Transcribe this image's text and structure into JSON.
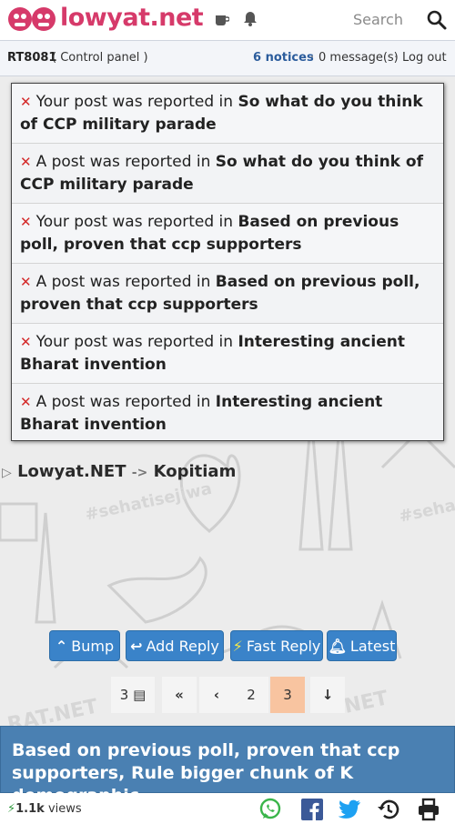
{
  "header": {
    "logo_text": "lowyat.net",
    "search_placeholder": "Search",
    "colors": {
      "logo": "#d63a6a",
      "accent": "#3a83c9"
    }
  },
  "userbar": {
    "username": "RT8081",
    "control_panel": "( Control panel )",
    "notices": "6 notices",
    "separator": "·",
    "messages": "0 message(s)",
    "logout": "Log out"
  },
  "notices": [
    {
      "prefix": "Your post was reported in ",
      "topic": "So what do you think of CCP military parade"
    },
    {
      "prefix": "A post was reported in ",
      "topic": "So what do you think of CCP military parade"
    },
    {
      "prefix": "Your post was reported in ",
      "topic": "Based on previous poll, proven that ccp supporters"
    },
    {
      "prefix": "A post was reported in ",
      "topic": "Based on previous poll, proven that ccp supporters"
    },
    {
      "prefix": "Your post was reported in ",
      "topic": "Interesting ancient Bharat invention"
    },
    {
      "prefix": "A post was reported in ",
      "topic": "Interesting ancient Bharat invention"
    }
  ],
  "breadcrumb": {
    "root": "Lowyat.NET",
    "arrow": "->",
    "forum": "Kopitiam"
  },
  "buttons": {
    "bump": "Bump",
    "add_reply": "Add Reply",
    "fast_reply": "Fast Reply",
    "latest": "Latest"
  },
  "pagination": {
    "total": "3",
    "first": "«",
    "prev": "‹",
    "page2": "2",
    "current": "3",
    "down": "↓"
  },
  "topic": {
    "title": "Based on previous poll, proven that ccp supporters, Rule bigger chunk of K demographic",
    "views_count": "1.1k",
    "views_label": " views"
  },
  "share_icons": [
    "whatsapp-icon",
    "facebook-icon",
    "twitter-icon",
    "history-icon",
    "print-icon"
  ]
}
